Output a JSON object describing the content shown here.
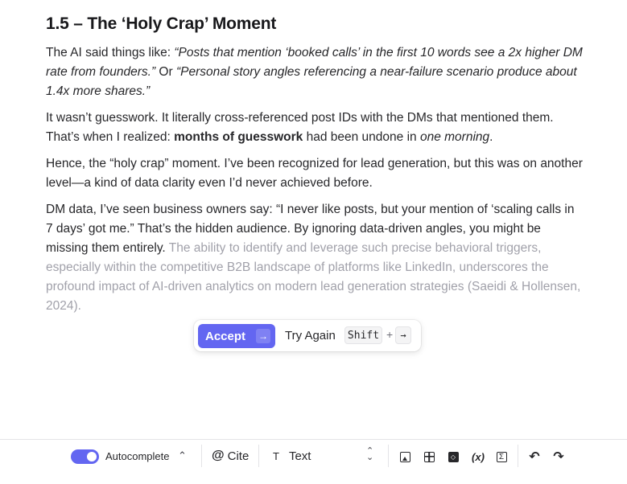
{
  "heading": "1.5 – The ‘Holy Crap’ Moment",
  "p1": {
    "prefix": "The AI said things like: ",
    "quote1": "“Posts that mention ‘booked calls’ in the first 10 words see a 2x higher DM rate from founders.”",
    "or": " Or ",
    "quote2": "“Personal story angles referencing a near-failure scenario produce about 1.4x more shares.”"
  },
  "p2": {
    "text1": "It wasn’t guesswork. It literally cross-referenced post IDs with the DMs that mentioned them. That’s when I realized: ",
    "bold": "months of guesswork",
    "text2": " had been undone in ",
    "italic": "one morning",
    "text3": "."
  },
  "p3": "Hence, the “holy crap” moment. I’ve been recognized for lead generation, but this was on another level—a kind of data clarity even I’d never achieved before.",
  "p4": {
    "text": "DM data, I’ve seen business owners say: “I never like posts, but your mention of ‘scaling calls in 7 days’ got me.” That’s the hidden audience. By ignoring data-driven angles, you might be missing them entirely.",
    "suggestion": " The ability to identify and leverage such precise behavioral triggers, especially within the competitive B2B landscape of platforms like LinkedIn, underscores the profound impact of AI-driven analytics on modern lead generation strategies (Saeidi & Hollensen, 2024)."
  },
  "suggest_bar": {
    "accept_label": "Accept",
    "accept_icon": "→",
    "try_again_label": "Try Again",
    "shift_key": "Shift",
    "plus": "+",
    "arrow_key": "→"
  },
  "toolbar": {
    "autocomplete_label": "Autocomplete",
    "autocomplete_on": true,
    "chevron": "⌃",
    "cite_label": "Cite",
    "cite_icon": "@",
    "text_icon": "T",
    "text_label": "Text",
    "var_label": "(x)",
    "accent_color": "#6366f1"
  }
}
